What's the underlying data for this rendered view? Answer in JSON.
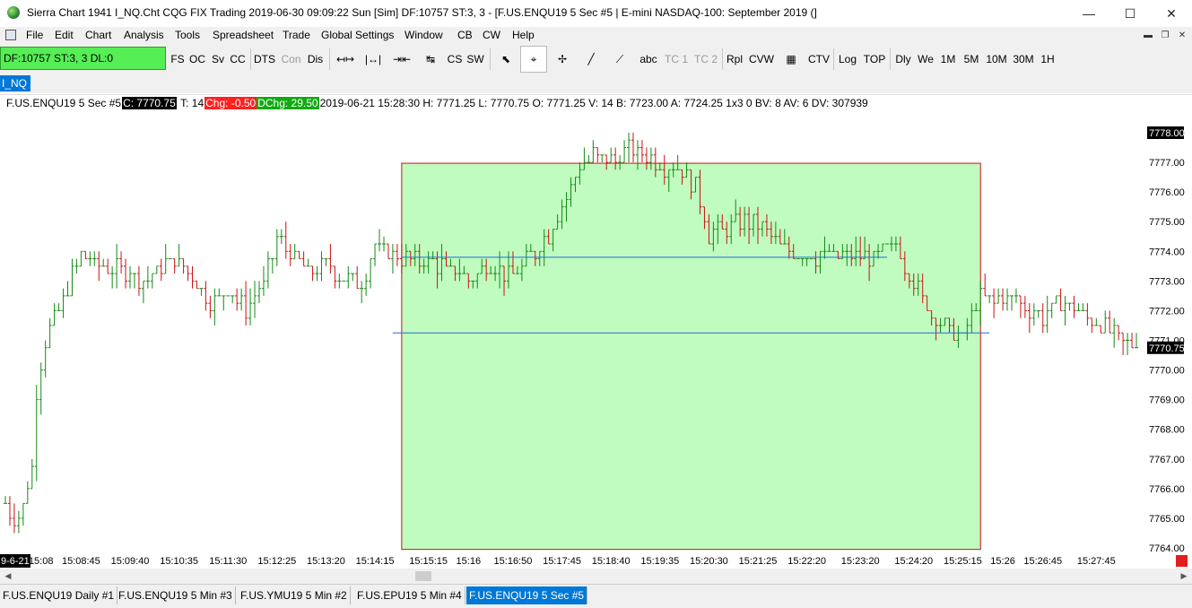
{
  "window": {
    "title": "Sierra Chart 1941 I_NQ.Cht  CQG FIX Trading 2019-06-30  09:09:22 Sun [Sim]  DF:10757  ST:3, 3 - [F.US.ENQU19  5 Sec   #5 | E-mini NASDAQ-100: September 2019 (]",
    "minimize": "—",
    "maximize": "☐",
    "close": "✕"
  },
  "menu": [
    "File",
    "Edit",
    "Chart",
    "Analysis",
    "Tools",
    "Spreadsheet",
    "Trade",
    "Global Settings",
    "Window",
    "CB",
    "CW",
    "Help"
  ],
  "mdi": {
    "minimize": "▬",
    "restore": "❐",
    "close": "✕"
  },
  "toolbar": {
    "status": "DF:10757  ST:3, 3  DL:0",
    "buttons": [
      "FS",
      "OC",
      "Sv",
      "CC",
      "DTS",
      "Con",
      "Dis",
      "abc",
      "TC 1",
      "TC 2",
      "Rpl",
      "CVW",
      "CTV",
      "Log",
      "TOP",
      "Dly",
      "We",
      "1M",
      "5M",
      "10M",
      "30M",
      "1H"
    ],
    "icons": [
      "↤↦",
      "|↔|",
      "⇥⇤",
      "↹",
      "CS",
      "SW",
      "⬉",
      "⌖",
      "✢",
      "╱",
      "⟋",
      "▦"
    ]
  },
  "chartbook_tab": "I_NQ",
  "info": {
    "symbol": "F.US.ENQU19  5 Sec   #5",
    "close": "C: 7770.75",
    "trades": "T: 14",
    "change": "Chg: -0.50",
    "daily_change": "DChg: 29.50",
    "rest": "2019-06-21 15:28:30 H: 7771.25  L: 7770.75  O: 7771.25  V: 14  B: 7723.00  A: 7724.25  1x3 0  BV: 8  AV: 6  DV: 307939"
  },
  "colors": {
    "up_bar": "#138a13",
    "down_bar": "#cc1111",
    "highlight_fill": "#c0fcc0",
    "highlight_border": "#d01010",
    "level_line": "#1a6fd8",
    "active_tab": "#0078d7"
  },
  "chart_data": {
    "type": "ohlc",
    "instrument": "F.US.ENQU19",
    "interval": "5 Sec",
    "price_range": [
      7764.0,
      7778.0
    ],
    "price_ticks": [
      7764.0,
      7765.0,
      7766.0,
      7767.0,
      7768.0,
      7769.0,
      7770.0,
      7771.0,
      7772.0,
      7773.0,
      7774.0,
      7775.0,
      7776.0,
      7777.0,
      7778.0
    ],
    "price_tick_labels": [
      "7764.00",
      "7765.00",
      "7766.00",
      "7767.00",
      "7768.00",
      "7769.00",
      "7770.00",
      "7771.00",
      "7772.00",
      "7773.00",
      "7774.00",
      "7775.00",
      "7776.00",
      "7777.00",
      "7778.00"
    ],
    "current_price_label": "7770.75",
    "top_price_label": "7778.00",
    "time_labels": [
      "15:08",
      "15:08:45",
      "15:09:40",
      "15:10:35",
      "15:11:30",
      "15:12:25",
      "15:13:20",
      "15:14:15",
      "15:15:15",
      "15:16",
      "15:16:50",
      "15:17:45",
      "15:18:40",
      "15:19:35",
      "15:20:30",
      "15:21:25",
      "15:22:20",
      "15:23:20",
      "15:24:20",
      "15:25:15",
      "15:26",
      "15:26:45",
      "15:27:45"
    ],
    "first_date_label": "9-6-21",
    "time_start": "15:07:20",
    "time_end": "15:28:30",
    "close_path": [
      [
        "15:07:20",
        7765.6
      ],
      [
        "15:07:30",
        7764.9
      ],
      [
        "15:07:40",
        7765.4
      ],
      [
        "15:07:50",
        7766.8
      ],
      [
        "15:07:55",
        7769.3
      ],
      [
        "15:08:00",
        7770.2
      ],
      [
        "15:08:10",
        7771.5
      ],
      [
        "15:08:20",
        7771.9
      ],
      [
        "15:08:30",
        7772.8
      ],
      [
        "15:08:45",
        7773.9
      ],
      [
        "15:09:00",
        7773.6
      ],
      [
        "15:09:20",
        7773.4
      ],
      [
        "15:09:40",
        7773.3
      ],
      [
        "15:10:00",
        7773.0
      ],
      [
        "15:10:20",
        7773.7
      ],
      [
        "15:10:35",
        7773.6
      ],
      [
        "15:10:50",
        7773.1
      ],
      [
        "15:11:10",
        7772.2
      ],
      [
        "15:11:30",
        7772.7
      ],
      [
        "15:11:50",
        7772.1
      ],
      [
        "15:12:10",
        7772.9
      ],
      [
        "15:12:25",
        7774.4
      ],
      [
        "15:12:40",
        7773.9
      ],
      [
        "15:13:00",
        7773.3
      ],
      [
        "15:13:20",
        7773.6
      ],
      [
        "15:13:40",
        7773.1
      ],
      [
        "15:14:00",
        7773.0
      ],
      [
        "15:14:15",
        7774.2
      ],
      [
        "15:14:35",
        7773.9
      ],
      [
        "15:14:55",
        7773.7
      ],
      [
        "15:15:15",
        7773.7
      ],
      [
        "15:15:35",
        7773.4
      ],
      [
        "15:16:00",
        7773.1
      ],
      [
        "15:16:20",
        7773.5
      ],
      [
        "15:16:50",
        7773.2
      ],
      [
        "15:17:10",
        7773.8
      ],
      [
        "15:17:30",
        7774.6
      ],
      [
        "15:17:45",
        7775.5
      ],
      [
        "15:18:00",
        7776.6
      ],
      [
        "15:18:20",
        7777.3
      ],
      [
        "15:18:40",
        7777.0
      ],
      [
        "15:19:00",
        7777.5
      ],
      [
        "15:19:20",
        7777.2
      ],
      [
        "15:19:35",
        7776.9
      ],
      [
        "15:19:55",
        7776.8
      ],
      [
        "15:20:15",
        7776.2
      ],
      [
        "15:20:30",
        7774.6
      ],
      [
        "15:20:50",
        7774.7
      ],
      [
        "15:21:10",
        7775.0
      ],
      [
        "15:21:25",
        7774.9
      ],
      [
        "15:21:45",
        7774.3
      ],
      [
        "15:22:05",
        7773.9
      ],
      [
        "15:22:20",
        7773.8
      ],
      [
        "15:22:40",
        7773.9
      ],
      [
        "15:23:00",
        7773.8
      ],
      [
        "15:23:20",
        7773.9
      ],
      [
        "15:23:40",
        7773.8
      ],
      [
        "15:24:00",
        7774.2
      ],
      [
        "15:24:20",
        7772.9
      ],
      [
        "15:24:40",
        7771.9
      ],
      [
        "15:25:00",
        7771.3
      ],
      [
        "15:25:15",
        7771.0
      ],
      [
        "15:25:35",
        7772.6
      ],
      [
        "15:25:50",
        7772.3
      ],
      [
        "15:26:10",
        7772.5
      ],
      [
        "15:26:30",
        7772.0
      ],
      [
        "15:26:45",
        7771.8
      ],
      [
        "15:27:05",
        7772.3
      ],
      [
        "15:27:25",
        7772.0
      ],
      [
        "15:27:45",
        7771.6
      ],
      [
        "15:28:05",
        7771.2
      ],
      [
        "15:28:30",
        7770.75
      ]
    ],
    "highlight_box": {
      "time_from": "15:14:45",
      "time_to": "15:25:35",
      "price_from": 7763.95,
      "price_to": 7776.97
    },
    "level_lines": [
      {
        "price": 7773.8,
        "time_from": "15:14:45",
        "time_to": "15:23:50"
      },
      {
        "price": 7771.25,
        "time_from": "15:14:35",
        "time_to": "15:25:45"
      }
    ]
  },
  "bottom_tabs": [
    {
      "label": "F.US.ENQU19  Daily  #1",
      "active": false
    },
    {
      "label": "F.US.ENQU19  5 Min  #3",
      "active": false
    },
    {
      "label": "F.US.YMU19  5 Min  #2",
      "active": false
    },
    {
      "label": "F.US.EPU19  5 Min  #4",
      "active": false
    },
    {
      "label": "F.US.ENQU19  5 Sec  #5",
      "active": true
    }
  ],
  "scroll": {
    "left": "◀",
    "right": "▶"
  }
}
